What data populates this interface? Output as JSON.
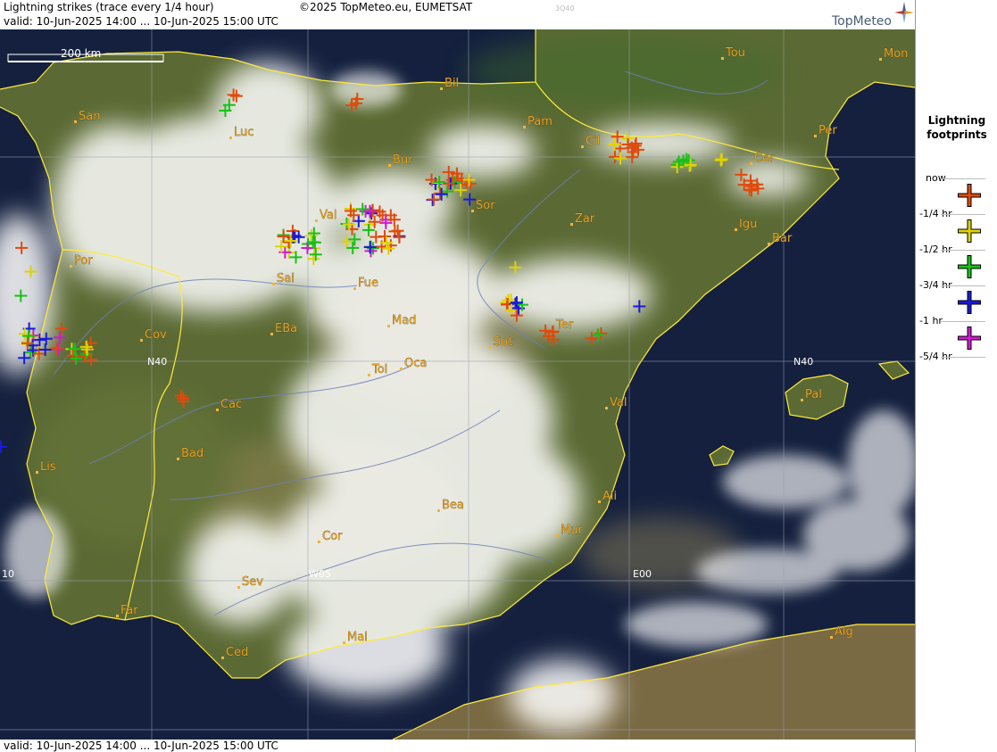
{
  "header": {
    "title": "Lightning strikes (trace every 1/4 hour)",
    "valid": "valid:  10-Jun-2025 14:00 ... 10-Jun-2025 15:00 UTC",
    "copyright": "©2025 TopMeteo.eu, EUMETSAT",
    "small_code": "3Q40",
    "logo": "TopMeteo"
  },
  "footer": {
    "valid": "valid:  10-Jun-2025 14:00 ... 10-Jun-2025 15:00 UTC"
  },
  "scale": {
    "label": "200 km"
  },
  "legend": {
    "title_line1": "Lightning",
    "title_line2": "footprints",
    "entries": [
      {
        "label": "now",
        "color": null
      },
      {
        "label": "-1/4 hr",
        "color": "#e04a0a"
      },
      {
        "label": "-1/2 hr",
        "color": "#e0d200"
      },
      {
        "label": "-3/4 hr",
        "color": "#18c018"
      },
      {
        "label": "-1 hr",
        "color": "#1a1adc"
      },
      {
        "label": "-5/4 hr",
        "color": "#d21ad2"
      }
    ]
  },
  "grid_labels": {
    "lat_n40_left": "N40",
    "lat_n40_right": "N40",
    "lon_w05": "W05",
    "lon_e00": "E00",
    "lon_w10": "10"
  },
  "cities": [
    {
      "name": "San"
    },
    {
      "name": "Luc"
    },
    {
      "name": "Bil"
    },
    {
      "name": "Tou"
    },
    {
      "name": "Mon"
    },
    {
      "name": "Pam"
    },
    {
      "name": "Bur"
    },
    {
      "name": "Cil"
    },
    {
      "name": "Per"
    },
    {
      "name": "Cer"
    },
    {
      "name": "Val"
    },
    {
      "name": "Sor"
    },
    {
      "name": "Zar"
    },
    {
      "name": "Igu"
    },
    {
      "name": "Bar"
    },
    {
      "name": "Por"
    },
    {
      "name": "Sal"
    },
    {
      "name": "Fue"
    },
    {
      "name": "Mad"
    },
    {
      "name": "Cov"
    },
    {
      "name": "EBa"
    },
    {
      "name": "Sot"
    },
    {
      "name": "Ter"
    },
    {
      "name": "Tol"
    },
    {
      "name": "Oca"
    },
    {
      "name": "Cac"
    },
    {
      "name": "Val"
    },
    {
      "name": "Pal"
    },
    {
      "name": "Bad"
    },
    {
      "name": "Lis"
    },
    {
      "name": "Ali"
    },
    {
      "name": "Bea"
    },
    {
      "name": "Mur"
    },
    {
      "name": "Cor"
    },
    {
      "name": "Sev"
    },
    {
      "name": "Far"
    },
    {
      "name": "Mal"
    },
    {
      "name": "Ced"
    },
    {
      "name": "Alg"
    }
  ]
}
